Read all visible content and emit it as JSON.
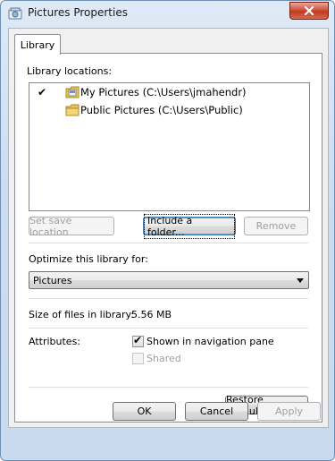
{
  "window": {
    "title": "Pictures Properties",
    "close_icon": "close-icon"
  },
  "tabs": [
    {
      "label": "Library",
      "selected": true
    }
  ],
  "library": {
    "locations_label": "Library locations:",
    "locations": [
      {
        "text": "My Pictures (C:\\Users\\jmahendr)",
        "save_location": true,
        "check": "✔"
      },
      {
        "text": "Public Pictures (C:\\Users\\Public)",
        "save_location": false,
        "check": ""
      }
    ],
    "buttons": {
      "set_save_location": "Set save location",
      "include_folder": "Include a folder...",
      "remove": "Remove"
    },
    "optimize_label": "Optimize this library for:",
    "optimize_value": "Pictures",
    "size_label": "Size of files in library:",
    "size_value": "5.56 MB",
    "attributes_label": "Attributes:",
    "attributes": [
      {
        "label": "Shown in navigation pane",
        "checked": true,
        "enabled": true
      },
      {
        "label": "Shared",
        "checked": false,
        "enabled": false
      }
    ],
    "restore_defaults": "Restore Defaults"
  },
  "dialog_buttons": {
    "ok": "OK",
    "cancel": "Cancel",
    "apply": "Apply"
  },
  "colors": {
    "close_red": "#c23a22",
    "focus_blue": "#3c7fb1",
    "disabled_text": "#a0a0a0"
  }
}
